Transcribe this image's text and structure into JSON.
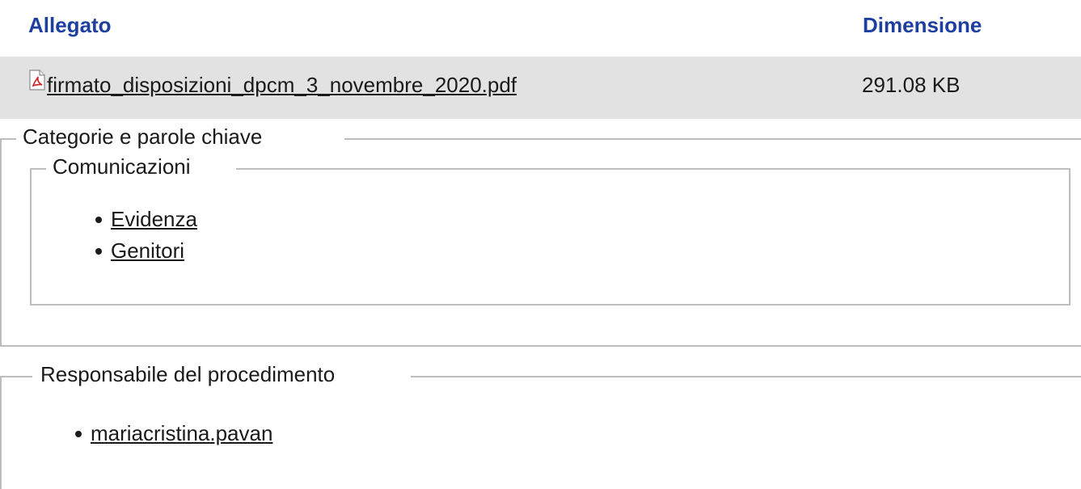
{
  "attachments": {
    "header_name": "Allegato",
    "header_size": "Dimensione",
    "rows": [
      {
        "file_name": "firmato_disposizioni_dpcm_3_novembre_2020.pdf",
        "size": "291.08 KB",
        "icon": "pdf-file-icon"
      }
    ]
  },
  "categories": {
    "legend": "Categorie e parole chiave",
    "group": {
      "legend": "Comunicazioni",
      "items": [
        "Evidenza",
        "Genitori"
      ]
    }
  },
  "responsible": {
    "legend": "Responsabile del procedimento",
    "items": [
      "mariacristina.pavan"
    ]
  },
  "colors": {
    "header_text": "#1d3fa0",
    "row_background": "#e2e2e2",
    "border": "#bdbdbd",
    "pdf_icon_red": "#d22020"
  }
}
